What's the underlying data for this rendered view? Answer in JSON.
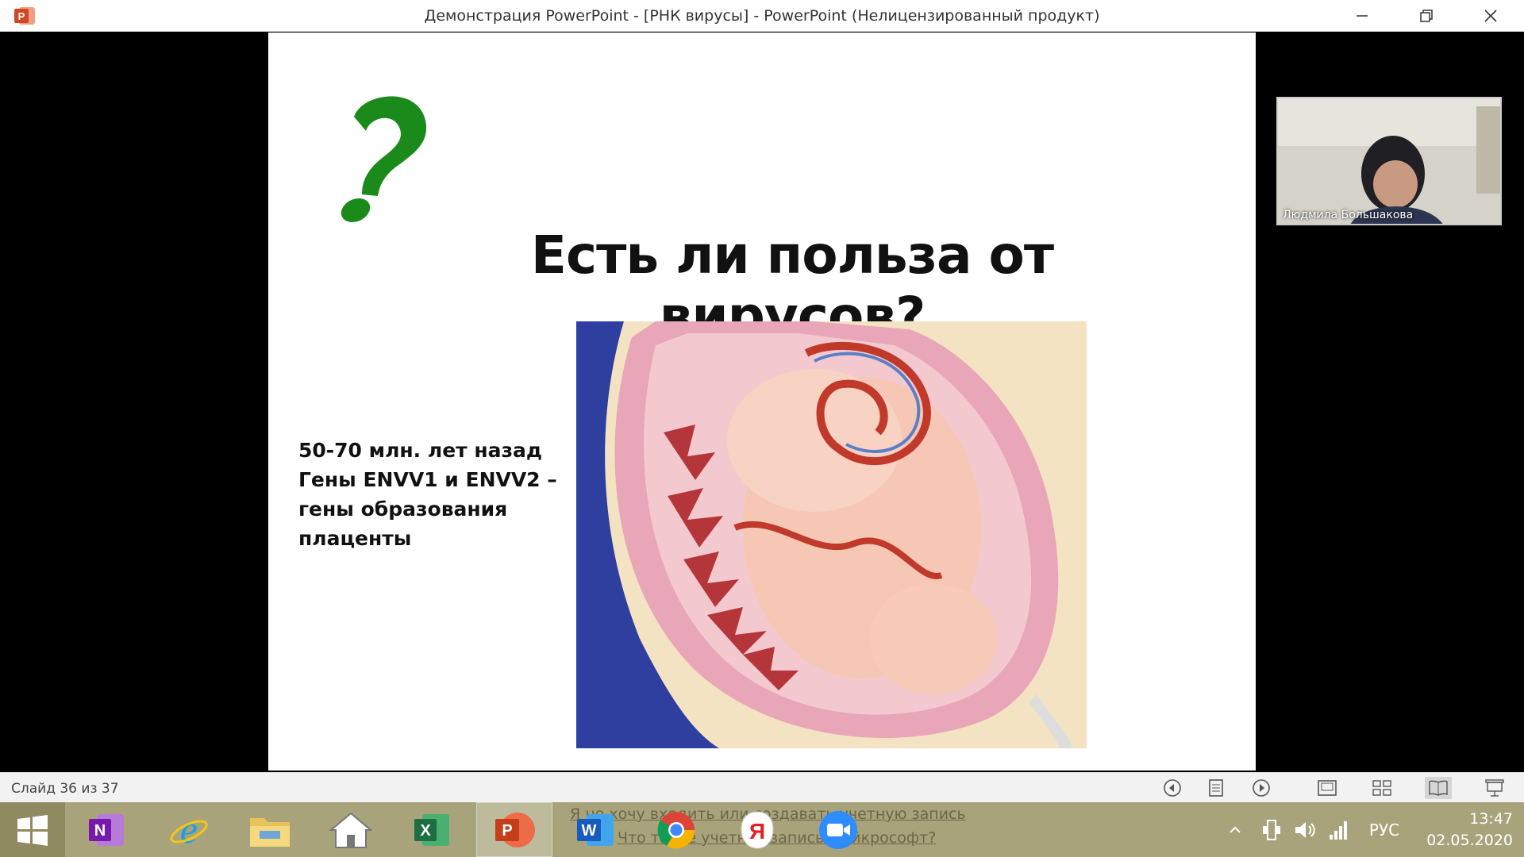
{
  "window": {
    "title": "Демонстрация PowerPoint - [РНК вирусы] - PowerPoint (Нелицензированный продукт)",
    "app_icon": "powerpoint-icon",
    "controls": [
      "minimize-icon",
      "restore-icon",
      "close-icon"
    ]
  },
  "slide": {
    "title": "Есть ли польза от вирусов?",
    "text_lines": [
      "50-70 млн. лет назад",
      "Гены ENVV1 и ENVV2 –",
      "гены образования",
      "плаценты"
    ],
    "question_mark_color": "#1a8a1a"
  },
  "video": {
    "participant_name": "Людмила Большакова"
  },
  "statusbar": {
    "slide_counter": "Слайд 36 из 37",
    "icons": [
      "previous-icon",
      "notes-icon",
      "next-icon",
      "normal-view-icon",
      "slide-sorter-icon",
      "reading-view-icon",
      "slideshow-icon"
    ]
  },
  "taskbar": {
    "apps": [
      "windows-start-icon",
      "onenote-icon",
      "internet-explorer-icon",
      "file-explorer-icon",
      "home-icon",
      "excel-icon",
      "powerpoint-icon",
      "word-icon",
      "chrome-icon",
      "yandex-icon",
      "zoom-icon"
    ],
    "background_link_1": "Я не хочу входить или создавать учетную запись",
    "background_link_2": "Что такое учетная запись Майкрософт?",
    "language": "РУС",
    "time": "13:47",
    "date": "02.05.2020"
  }
}
